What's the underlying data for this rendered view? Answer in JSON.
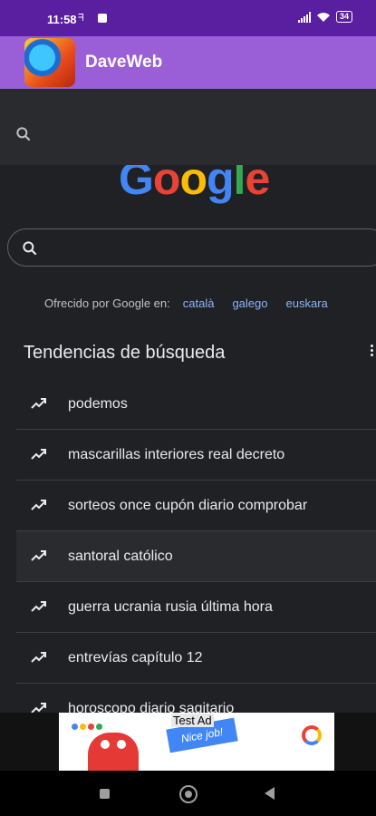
{
  "status_bar": {
    "time": "11:58",
    "notification": "ᖷ",
    "battery": "34"
  },
  "app_bar": {
    "title": "DaveWeb"
  },
  "search": {
    "placeholder": "",
    "value": ""
  },
  "google_logo": {
    "letters": [
      "G",
      "o",
      "o",
      "g",
      "l",
      "e"
    ]
  },
  "offered_by": {
    "prefix": "Ofrecido por Google en:",
    "languages": [
      "català",
      "galego",
      "euskara"
    ]
  },
  "trends": {
    "title": "Tendencias de búsqueda",
    "items": [
      "podemos",
      "mascarillas interiores real decreto",
      "sorteos once cupón diario comprobar",
      "santoral católico",
      "guerra ucrania rusia última hora",
      "entrevías capítulo 12",
      "horoscopo diario sagitario"
    ]
  },
  "ad": {
    "label": "Test Ad",
    "flag_text": "Nice job!"
  },
  "colors": {
    "status_bar": "#5a1fa0",
    "app_bar": "#9a5fd6",
    "link": "#8ab4f8",
    "background": "#202124"
  }
}
